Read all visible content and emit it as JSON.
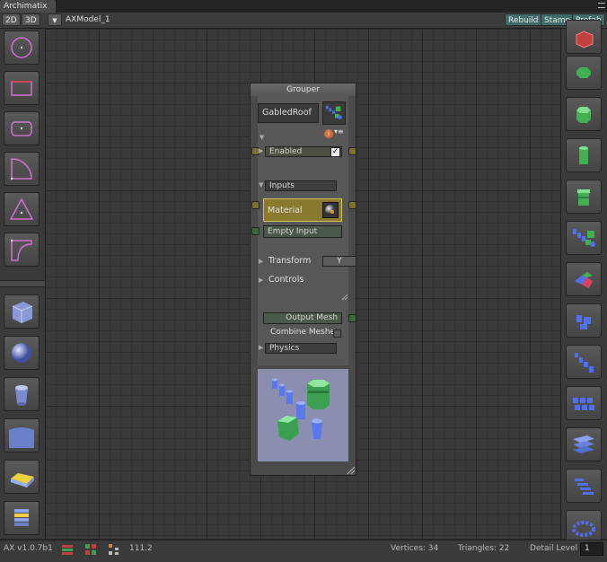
{
  "window": {
    "tab_title": "Archimatix"
  },
  "toolbar": {
    "mode_2d": "2D",
    "mode_3d": "3D",
    "dropdown_arrow": "▼",
    "model_name": "AXModel_1",
    "rebuild": "Rebuild",
    "stamp": "Stamp",
    "prefab": "Prefab"
  },
  "left_tools": [
    {
      "name": "circle-shape-tool",
      "icon": "circle-shape-icon"
    },
    {
      "name": "rectangle-shape-tool",
      "icon": "rectangle-shape-icon"
    },
    {
      "name": "rounded-rect-shape-tool",
      "icon": "rounded-rect-icon"
    },
    {
      "name": "arc-shape-tool",
      "icon": "arc-shape-icon"
    },
    {
      "name": "triangle-shape-tool",
      "icon": "triangle-shape-icon"
    },
    {
      "name": "fillet-shape-tool",
      "icon": "fillet-shape-icon"
    },
    {
      "name": "box-mesh-tool",
      "icon": "box-mesh-icon"
    },
    {
      "name": "sphere-mesh-tool",
      "icon": "sphere-mesh-icon"
    },
    {
      "name": "cylinder-mesh-tool",
      "icon": "cylinder-mesh-icon"
    },
    {
      "name": "curved-plane-tool",
      "icon": "curved-plane-icon"
    },
    {
      "name": "slab-mesh-tool",
      "icon": "slab-mesh-icon"
    },
    {
      "name": "layered-mesh-tool",
      "icon": "layered-mesh-icon"
    }
  ],
  "right_tools": [
    {
      "name": "red-cube-tool",
      "icon": "red-cube-icon"
    },
    {
      "name": "octagon-plate-tool",
      "icon": "octagon-plate-icon"
    },
    {
      "name": "octagon-extrude-tool",
      "icon": "octagon-extrude-icon"
    },
    {
      "name": "green-cylinder-tool",
      "icon": "green-cylinder-icon"
    },
    {
      "name": "green-tower-tool",
      "icon": "green-tower-icon"
    },
    {
      "name": "grouper-tool",
      "icon": "grouper-icon"
    },
    {
      "name": "replicant-tool",
      "icon": "replicant-icon"
    },
    {
      "name": "radial-repeater-tool",
      "icon": "radial-repeater-icon"
    },
    {
      "name": "linear-repeater-tool",
      "icon": "linear-repeater-icon"
    },
    {
      "name": "grid-repeater-tool",
      "icon": "grid-repeater-icon"
    },
    {
      "name": "floor-repeater-tool",
      "icon": "floor-repeater-icon"
    },
    {
      "name": "stair-repeater-tool",
      "icon": "stair-repeater-icon"
    },
    {
      "name": "ring-repeater-tool",
      "icon": "ring-repeater-icon"
    }
  ],
  "node": {
    "title": "Grouper",
    "name_value": "GabledRoof",
    "info_symbol": "i",
    "menu_symbol": "▾≡",
    "enabled_label": "Enabled",
    "enabled_checked": "✓",
    "inputs_label": "Inputs",
    "material_label": "Material",
    "empty_input_label": "Empty Input",
    "transform_label": "Transform",
    "transform_axis": "Y",
    "controls_label": "Controls",
    "output_mesh_label": "Output Mesh",
    "combine_meshes_label": "Combine Meshe",
    "physics_label": "Physics",
    "arrow_right": "▶",
    "arrow_down": "▼"
  },
  "status": {
    "version": "AX v1.0.7b1",
    "zoom_value": "111.2",
    "vertices": "Vertices: 34",
    "triangles": "Triangles: 22",
    "detail_level_label": "Detail Level",
    "detail_level_value": "1"
  },
  "colors": {
    "accent_yellow": "#d6c25a",
    "socket_yellow": "#7a7030",
    "socket_green": "#3a6a3a",
    "preview_bg": "#8a8fb0",
    "toolbar_teal": "#3f6b6b"
  }
}
